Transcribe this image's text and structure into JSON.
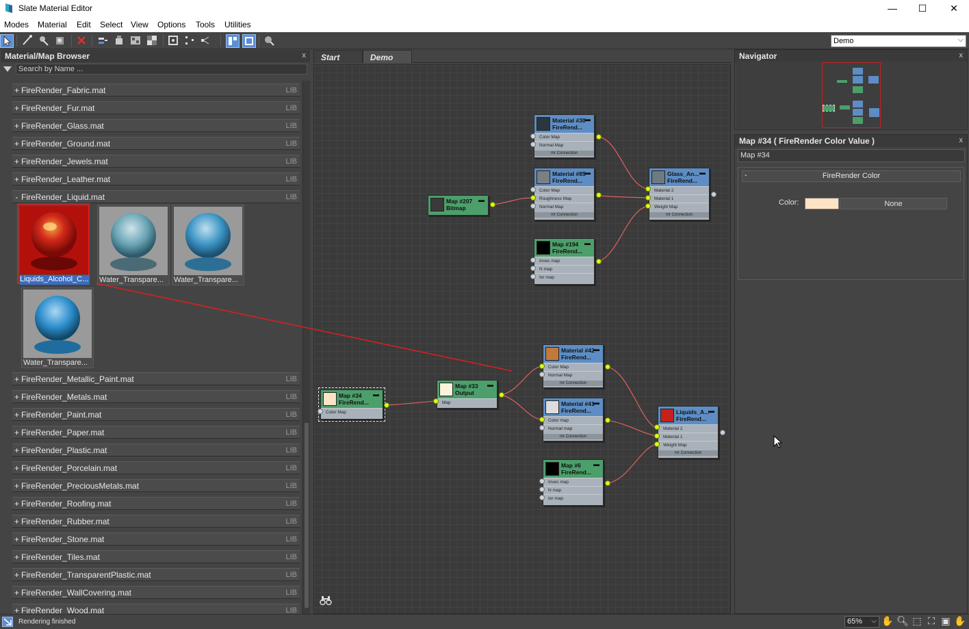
{
  "window": {
    "title": "Slate Material Editor",
    "minimize": "—",
    "maximize": "☐",
    "close": "✕"
  },
  "menu": [
    "Modes",
    "Material",
    "Edit",
    "Select",
    "View",
    "Options",
    "Tools",
    "Utilities"
  ],
  "toolbar": {
    "view_select": "Demo"
  },
  "browser": {
    "title": "Material/Map Browser",
    "close": "x",
    "search_placeholder": "Search by Name ...",
    "tag": "LIB",
    "items_top": [
      "FireRender_Fabric.mat",
      "FireRender_Fur.mat",
      "FireRender_Glass.mat",
      "FireRender_Ground.mat",
      "FireRender_Jewels.mat",
      "FireRender_Leather.mat"
    ],
    "expanded": "FireRender_Liquid.mat",
    "thumbnails": [
      {
        "label": "Liquids_Alcohol_C...",
        "selected": true,
        "color": "#c8201a"
      },
      {
        "label": "Water_Transpare...",
        "selected": false,
        "color": "#6fa6b8"
      },
      {
        "label": "Water_Transpare...",
        "selected": false,
        "color": "#3f93c4"
      },
      {
        "label": "Water_Transpare...",
        "selected": false,
        "color": "#2f8cc7"
      }
    ],
    "items_bottom": [
      "FireRender_Metallic_Paint.mat",
      "FireRender_Metals.mat",
      "FireRender_Paint.mat",
      "FireRender_Paper.mat",
      "FireRender_Plastic.mat",
      "FireRender_Porcelain.mat",
      "FireRender_PreciousMetals.mat",
      "FireRender_Roofing.mat",
      "FireRender_Rubber.mat",
      "FireRender_Stone.mat",
      "FireRender_Tiles.mat",
      "FireRender_TransparentPlastic.mat",
      "FireRender_WallCovering.mat",
      "FireRender_Wood.mat"
    ]
  },
  "view_tabs": [
    "Start",
    "Demo"
  ],
  "nodes": {
    "m30": {
      "t1": "Material #30",
      "t2": "FireRend...",
      "rows": [
        "Color Map",
        "Normal Map"
      ],
      "foot": "mr Connection"
    },
    "m85": {
      "t1": "Material #85",
      "t2": "FireRend...",
      "rows": [
        "Color Map",
        "Roughness Map",
        "Normal Map"
      ],
      "foot": "mr Connection"
    },
    "glass": {
      "t1": "Glass_An...",
      "t2": "FireRend...",
      "rows": [
        "Material 2",
        "Material 1",
        "Weight Map"
      ],
      "foot": "mr Connection"
    },
    "map207": {
      "t1": "Map #207",
      "t2": "Bitmap"
    },
    "map194": {
      "t1": "Map #194",
      "t2": "FireRend...",
      "rows": [
        "Invec map",
        "N map",
        "Ior map"
      ]
    },
    "m42": {
      "t1": "Material #42",
      "t2": "FireRend...",
      "rows": [
        "Color Map",
        "Normal Map"
      ],
      "foot": "mr Connection"
    },
    "map33": {
      "t1": "Map #33",
      "t2": "Output",
      "rows": [
        "Map"
      ]
    },
    "map34": {
      "t1": "Map #34",
      "t2": "FireRend...",
      "rows": [
        "Color Map"
      ]
    },
    "m41": {
      "t1": "Material #41",
      "t2": "FireRend...",
      "rows": [
        "Color map",
        "Normal map"
      ],
      "foot": "mr Connection"
    },
    "liquids": {
      "t1": "Liquids_A...",
      "t2": "FireRend...",
      "rows": [
        "Material 2",
        "Material 1",
        "Weight Map"
      ],
      "foot": "mr Connection"
    },
    "map6": {
      "t1": "Map #6",
      "t2": "FireRend...",
      "rows": [
        "Invec map",
        "N map",
        "Ior map"
      ]
    }
  },
  "navigator": {
    "title": "Navigator",
    "close": "x"
  },
  "params": {
    "title": "Map #34  ( FireRender Color Value )",
    "close": "x",
    "name": "Map #34",
    "rollout": "FireRender Color",
    "rollout_toggle": "-",
    "color_label": "Color:",
    "color_value": "#fde3c5",
    "map_button": "None"
  },
  "status": {
    "text": "Rendering finished",
    "zoom": "65%"
  }
}
